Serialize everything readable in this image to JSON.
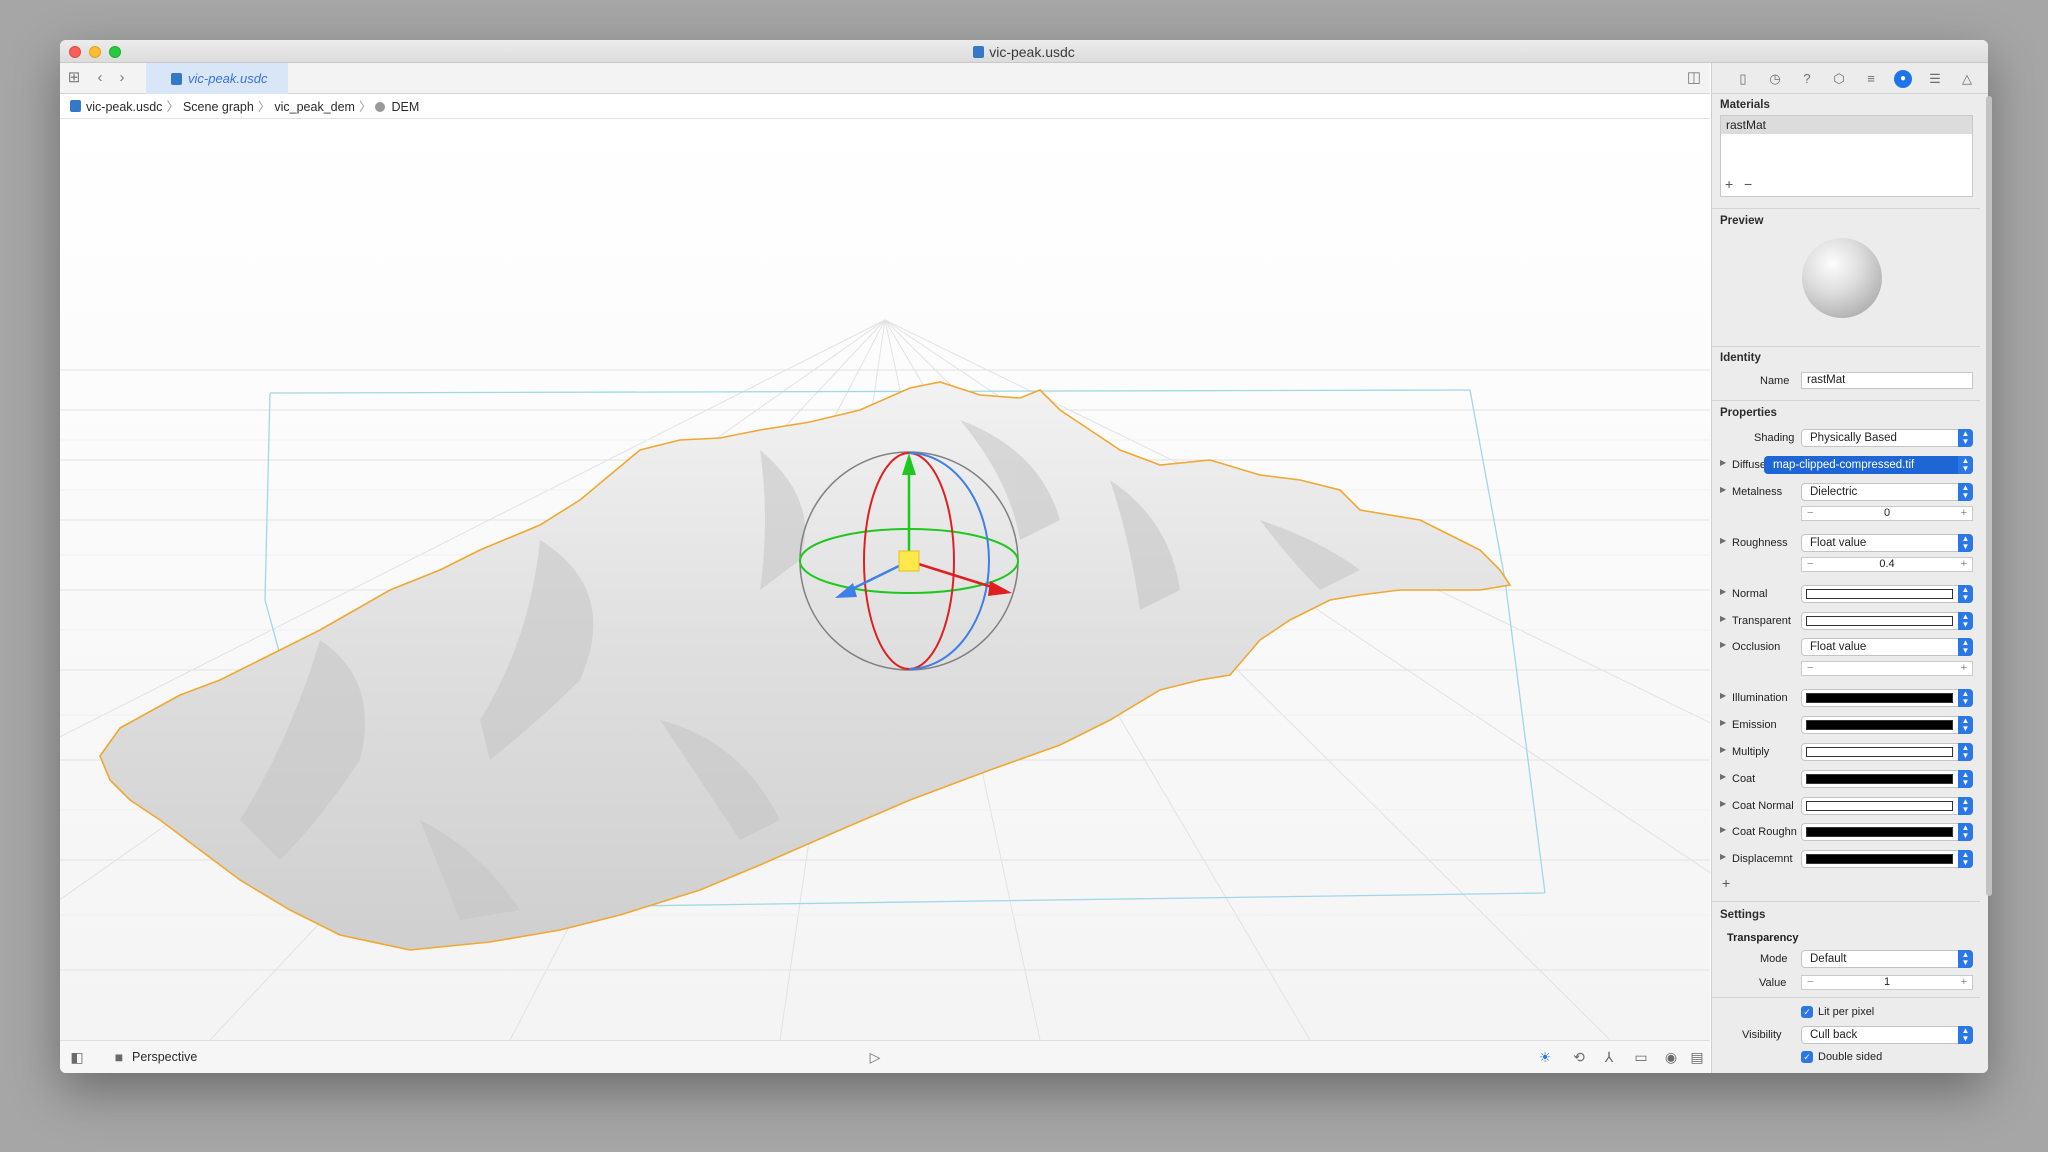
{
  "window": {
    "title": "vic-peak.usdc"
  },
  "tabs": [
    {
      "label": "vic-peak.usdc",
      "active": true
    }
  ],
  "breadcrumb": [
    "vic-peak.usdc",
    "Scene graph",
    "vic_peak_dem",
    "DEM"
  ],
  "statusbar": {
    "camera_label": "Perspective"
  },
  "inspector": {
    "materials": {
      "title": "Materials",
      "items": [
        "rastMat"
      ],
      "add": "+",
      "remove": "−"
    },
    "preview": {
      "title": "Preview"
    },
    "identity": {
      "title": "Identity",
      "name_label": "Name",
      "name_value": "rastMat"
    },
    "properties": {
      "title": "Properties",
      "shading": {
        "label": "Shading",
        "value": "Physically Based"
      },
      "diffuse": {
        "label": "Diffuse",
        "value": "map-clipped-compressed.tif"
      },
      "metalness": {
        "label": "Metalness",
        "value": "Dielectric",
        "number": "0"
      },
      "roughness": {
        "label": "Roughness",
        "value": "Float value",
        "number": "0.4"
      },
      "normal": {
        "label": "Normal"
      },
      "transparent": {
        "label": "Transparent"
      },
      "occlusion": {
        "label": "Occlusion",
        "value": "Float value",
        "number": ""
      },
      "illumination": {
        "label": "Illumination"
      },
      "emission": {
        "label": "Emission"
      },
      "multiply": {
        "label": "Multiply"
      },
      "coat": {
        "label": "Coat"
      },
      "coat_normal": {
        "label": "Coat Normal"
      },
      "coat_roughness": {
        "label": "Coat Roughn"
      },
      "displacement": {
        "label": "Displacemnt"
      },
      "add": "+"
    },
    "settings": {
      "title": "Settings",
      "transparency_title": "Transparency",
      "mode": {
        "label": "Mode",
        "value": "Default"
      },
      "value": {
        "label": "Value",
        "number": "1"
      },
      "lit_per_pixel": {
        "label": "Lit per pixel",
        "checked": true
      },
      "visibility": {
        "label": "Visibility",
        "value": "Cull back"
      },
      "double_sided": {
        "label": "Double sided",
        "checked": true
      }
    }
  },
  "colors": {
    "accent": "#1e74e8",
    "terrain_outline": "#f0a830",
    "bounding_box": "#9fd8e8",
    "gizmo_x": "#e02020",
    "gizmo_y": "#1ec81e",
    "gizmo_z": "#3f7fe8"
  }
}
